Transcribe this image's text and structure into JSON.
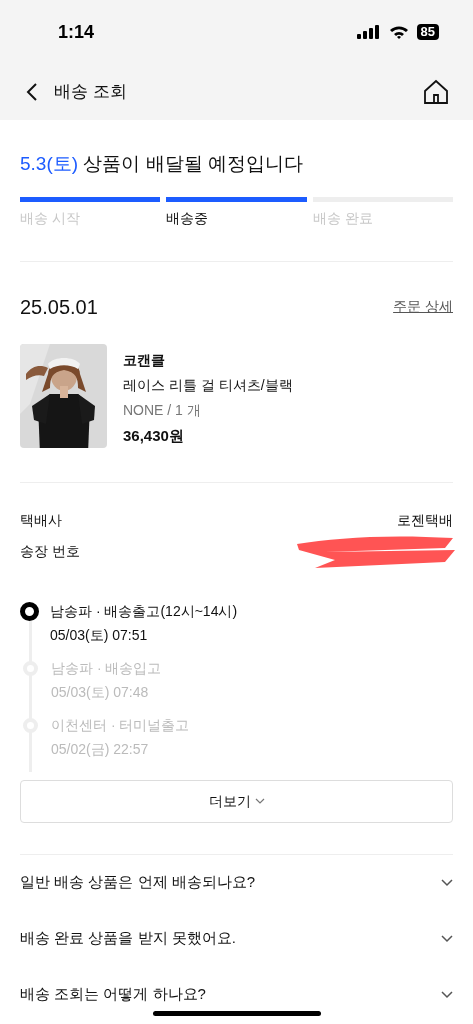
{
  "status_bar": {
    "time": "1:14",
    "battery": "85"
  },
  "header": {
    "title": "배송 조회"
  },
  "headline": {
    "date": "5.3(토)",
    "text": "상품이 배달될 예정입니다"
  },
  "steps": [
    {
      "label": "배송 시작",
      "done": true,
      "selected": false
    },
    {
      "label": "배송중",
      "done": true,
      "selected": true
    },
    {
      "label": "배송 완료",
      "done": false,
      "selected": false
    }
  ],
  "order": {
    "date": "25.05.01",
    "detail_link": "주문 상세",
    "product": {
      "brand": "코캔클",
      "name": "레이스 리틀 걸 티셔츠/블랙",
      "option": "NONE / 1 개",
      "price": "36,430원"
    }
  },
  "shipping": [
    {
      "label": "택배사",
      "value": "로젠택배"
    },
    {
      "label": "송장 번호",
      "redacted": true
    }
  ],
  "tracking": [
    {
      "title": "남송파 · 배송출고(12시~14시)",
      "time": "05/03(토) 07:51",
      "current": true
    },
    {
      "title": "남송파 · 배송입고",
      "time": "05/03(토) 07:48",
      "current": false
    },
    {
      "title": "이천센터 · 터미널출고",
      "time": "05/02(금) 22:57",
      "current": false
    }
  ],
  "more_button": "더보기",
  "faq": [
    {
      "question": "일반 배송 상품은 언제 배송되나요?",
      "expanded": false
    },
    {
      "question": "배송 완료 상품을 받지 못했어요.",
      "expanded": false
    },
    {
      "question": "배송 조회는 어떻게 하나요?",
      "expanded": false
    }
  ]
}
